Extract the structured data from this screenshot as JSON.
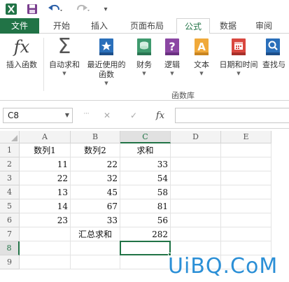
{
  "quick_access": {
    "customize_arrow": "▾"
  },
  "tabs": [
    {
      "label": "文件"
    },
    {
      "label": "开始"
    },
    {
      "label": "插入"
    },
    {
      "label": "页面布局"
    },
    {
      "label": "公式"
    },
    {
      "label": "数据"
    },
    {
      "label": "审阅"
    }
  ],
  "ribbon": {
    "buttons": [
      {
        "label": "插入函数",
        "icon": "fx-icon"
      },
      {
        "label": "自动求和",
        "icon": "sigma-icon",
        "has_dropdown": true
      },
      {
        "label": "最近使用的",
        "label2": "函数",
        "icon": "star-book-icon",
        "has_dropdown": true
      },
      {
        "label": "财务",
        "icon": "coins-book-icon",
        "has_dropdown": true
      },
      {
        "label": "逻辑",
        "icon": "question-book-icon",
        "has_dropdown": true
      },
      {
        "label": "文本",
        "icon": "text-book-icon",
        "has_dropdown": true
      },
      {
        "label": "日期和时间",
        "icon": "calendar-book-icon",
        "has_dropdown": true
      },
      {
        "label": "查找与",
        "icon": "search-book-icon"
      }
    ],
    "group_label": "函数库"
  },
  "formula_bar": {
    "name_box": "C8",
    "cancel_glyph": "✕",
    "enter_glyph": "✓",
    "fx_glyph": "fx",
    "formula": ""
  },
  "grid": {
    "columns": [
      "A",
      "B",
      "C",
      "D",
      "E"
    ],
    "selected_column": "C",
    "rows": [
      "1",
      "2",
      "3",
      "4",
      "5",
      "6",
      "7",
      "8",
      "9"
    ],
    "selected_row": "8",
    "cells": {
      "A1": "数列1",
      "B1": "数列2",
      "C1": "求和",
      "A2": "11",
      "B2": "22",
      "C2": "33",
      "A3": "22",
      "B3": "32",
      "C3": "54",
      "A4": "13",
      "B4": "45",
      "C4": "58",
      "A5": "14",
      "B5": "67",
      "C5": "81",
      "A6": "23",
      "B6": "33",
      "C6": "56",
      "B7": "汇总求和",
      "C7": "282"
    }
  },
  "watermark": {
    "text": "UiBQ.CoM"
  },
  "colors": {
    "excel_green": "#217346",
    "watermark_blue": "#2b8fd6"
  }
}
